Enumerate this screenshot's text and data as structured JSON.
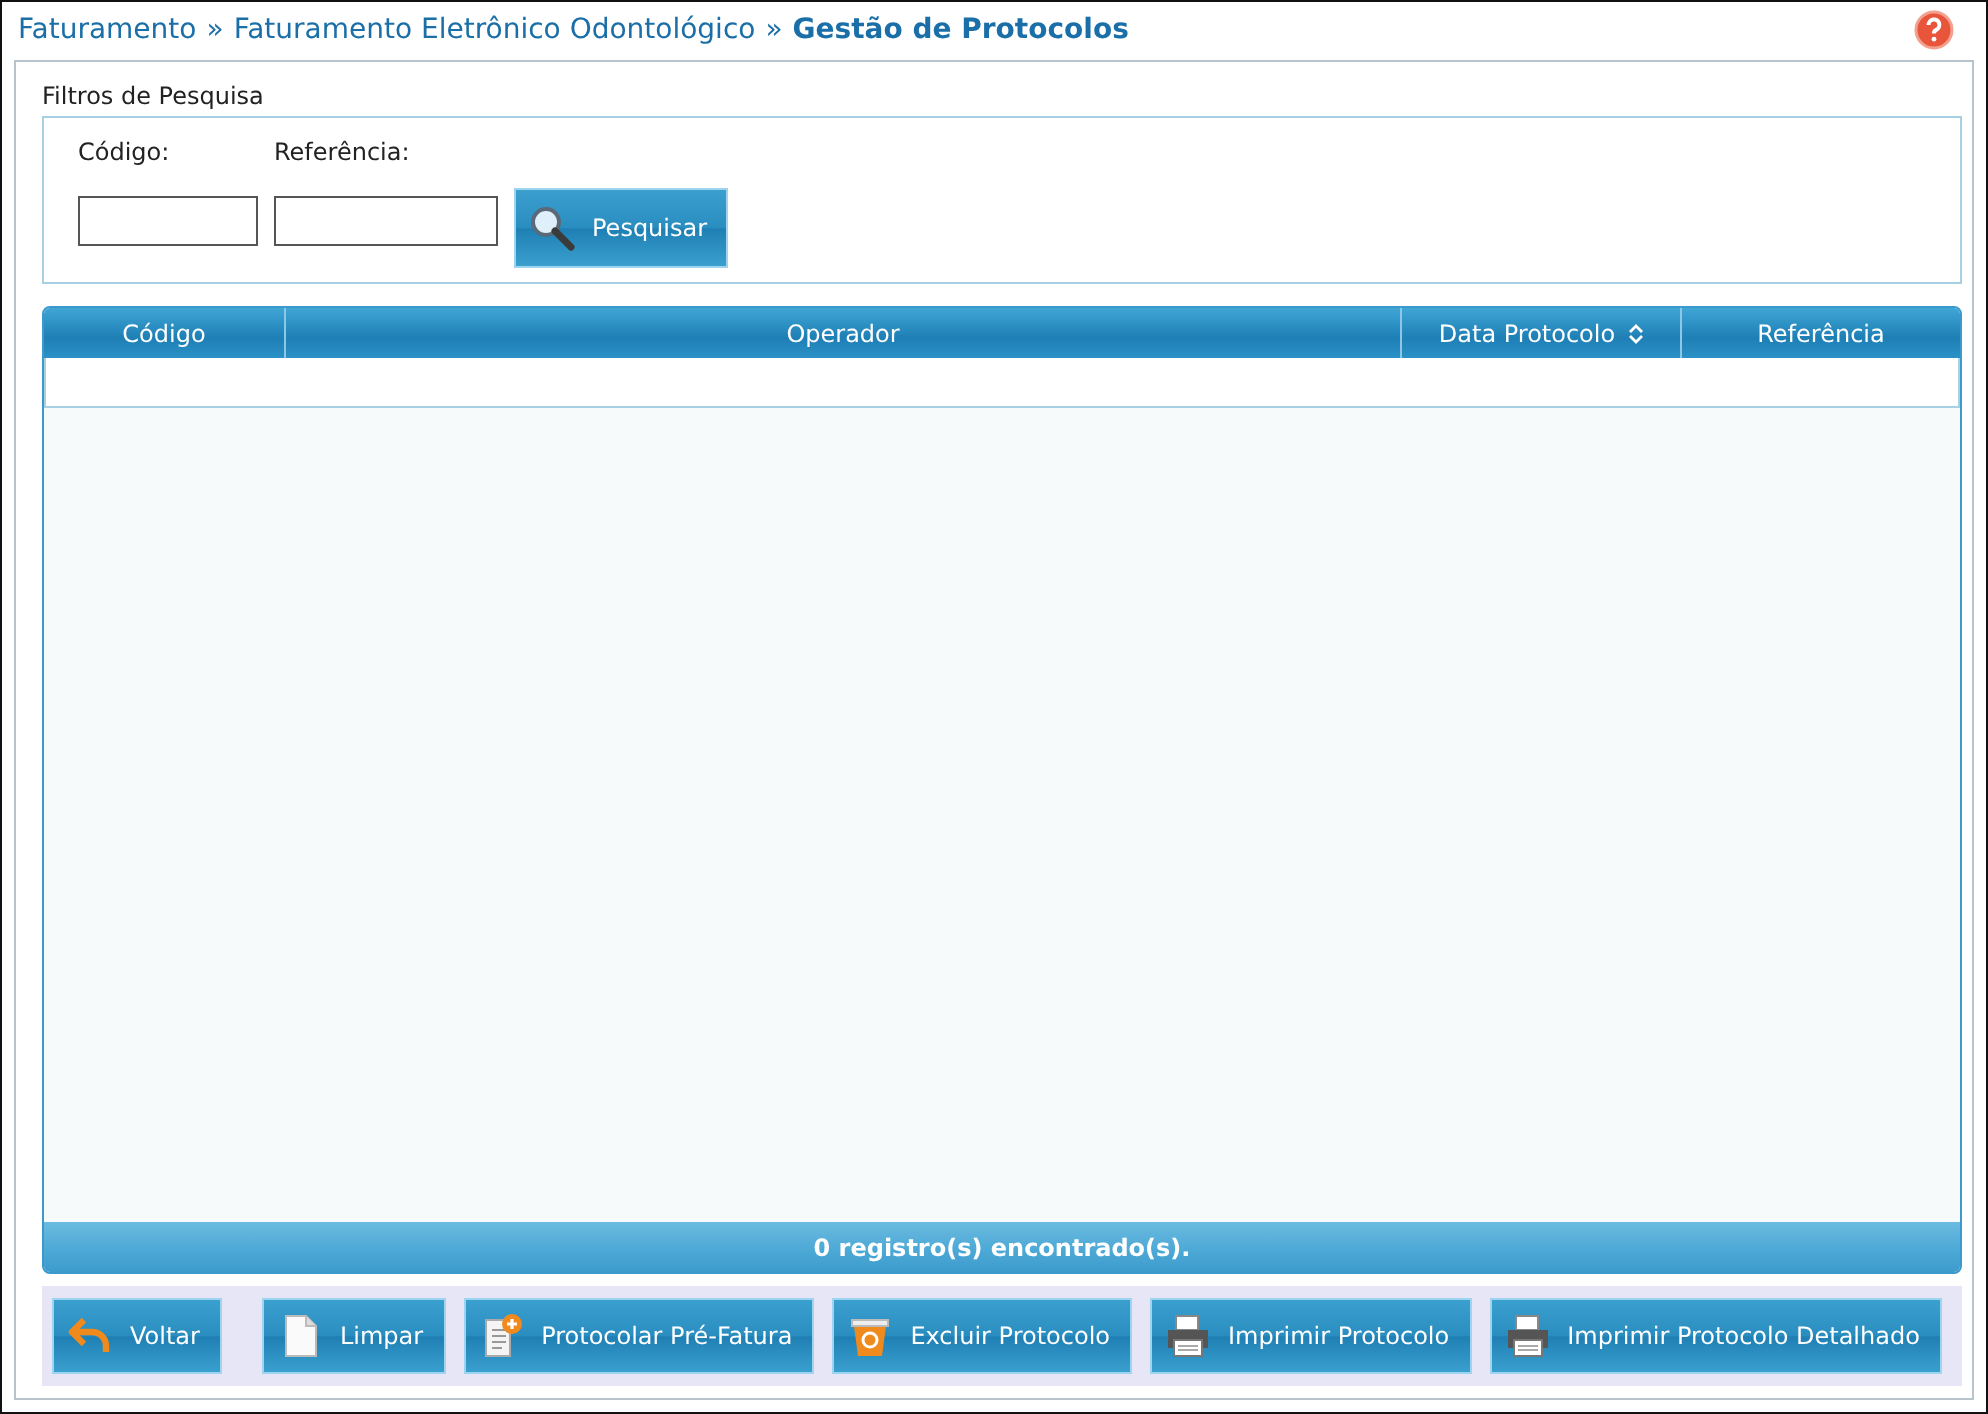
{
  "breadcrumb": [
    {
      "label": "Faturamento",
      "kind": "link"
    },
    {
      "label": "»",
      "kind": "sep"
    },
    {
      "label": "Faturamento Eletrônico Odontológico",
      "kind": "link"
    },
    {
      "label": "»",
      "kind": "sep"
    },
    {
      "label": "Gestão de Protocolos",
      "kind": "current"
    }
  ],
  "filters": {
    "legend": "Filtros de Pesquisa",
    "fields": [
      {
        "label": "Código:"
      },
      {
        "label": "Referência:"
      }
    ],
    "search_button": "Pesquisar"
  },
  "table": {
    "columns": [
      {
        "label": "Código",
        "sortable": false
      },
      {
        "label": "Operador",
        "sortable": false
      },
      {
        "label": "Data Protocolo",
        "sortable": true
      },
      {
        "label": "Referência",
        "sortable": false
      }
    ],
    "footer": "0 registro(s) encontrado(s)."
  },
  "buttons": [
    {
      "label": "Voltar",
      "kind": "back"
    },
    {
      "label": "Limpar",
      "kind": "clear"
    },
    {
      "label": "Protocolar Pré-Fatura",
      "kind": "add"
    },
    {
      "label": "Excluir Protocolo",
      "kind": "delete"
    },
    {
      "label": "Imprimir Protocolo",
      "kind": "print"
    },
    {
      "label": "Imprimir Protocolo Detalhado",
      "kind": "print"
    }
  ]
}
